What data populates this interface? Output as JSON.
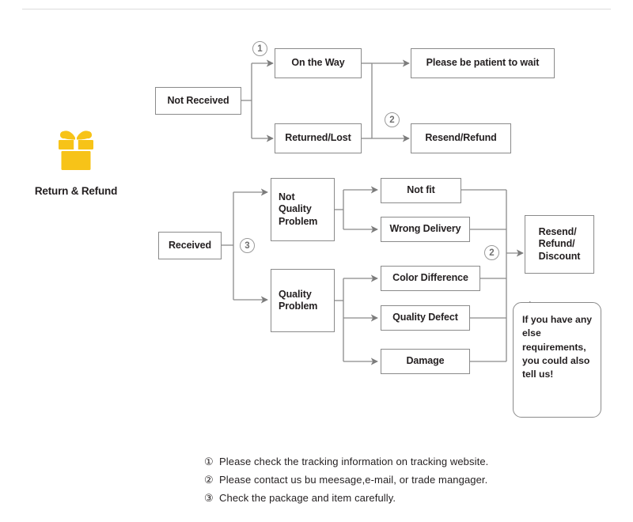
{
  "brand": {
    "icon": "gift-box-icon",
    "icon_color": "#F7C318",
    "label": "Return & Refund"
  },
  "theme": {
    "line_color": "#8a8a8a",
    "text_color": "#231f20",
    "marker_color": "#9a9a9a",
    "rule_color": "#dcdcdc"
  },
  "flow": {
    "not_received": {
      "label": "Not Received",
      "branches": [
        {
          "label": "On the Way",
          "marker": "1",
          "result": "Please be patient to wait"
        },
        {
          "label": "Returned/Lost",
          "marker": "2",
          "result": "Resend/Refund"
        }
      ]
    },
    "received": {
      "label": "Received",
      "marker": "3",
      "groups": [
        {
          "label": "Not\nQuality\nProblem",
          "reasons": [
            "Not fit",
            "Wrong Delivery"
          ]
        },
        {
          "label": "Quality\nProblem",
          "reasons": [
            "Color Difference",
            "Quality Defect",
            "Damage"
          ]
        }
      ],
      "outcome_marker": "2",
      "outcome": "Resend/\nRefund/\nDiscount"
    }
  },
  "labels": {
    "not_received": "Not Received",
    "on_the_way": "On the Way",
    "returned_lost": "Returned/Lost",
    "please_wait": "Please be patient to wait",
    "resend_refund": "Resend/Refund",
    "received": "Received",
    "not_quality_problem": "Not\nQuality\nProblem",
    "quality_problem": "Quality\nProblem",
    "not_fit": "Not fit",
    "wrong_delivery": "Wrong Delivery",
    "color_difference": "Color Difference",
    "quality_defect": "Quality Defect",
    "damage": "Damage",
    "resend_refund_discount": "Resend/\nRefund/\nDiscount"
  },
  "markers": {
    "m1": "1",
    "m2_top": "2",
    "m3": "3",
    "m2_bottom": "2"
  },
  "bubble": {
    "text": "If you have any else requirements, you could also tell us!"
  },
  "notes": [
    {
      "num": "①",
      "text": "Please check the tracking information on tracking website."
    },
    {
      "num": "②",
      "text": "Please contact us bu meesage,e-mail, or trade mangager."
    },
    {
      "num": "③",
      "text": "Check the package and item carefully."
    }
  ]
}
